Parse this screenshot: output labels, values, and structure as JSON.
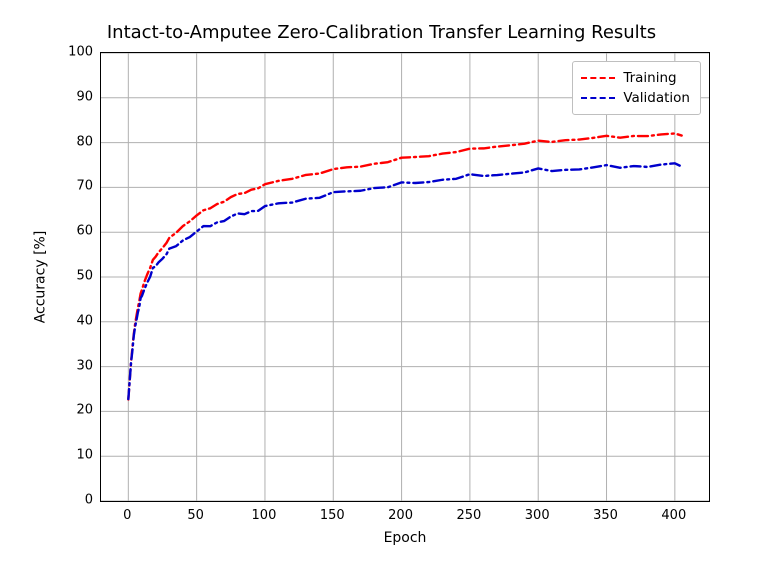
{
  "chart_data": {
    "type": "line",
    "title": "Intact-to-Amputee Zero-Calibration Transfer Learning Results",
    "xlabel": "Epoch",
    "ylabel": "Accuracy [%]",
    "xlim": [
      -20,
      425
    ],
    "ylim": [
      0,
      100
    ],
    "xticks": [
      0,
      50,
      100,
      150,
      200,
      250,
      300,
      350,
      400
    ],
    "yticks": [
      0,
      10,
      20,
      30,
      40,
      50,
      60,
      70,
      80,
      90,
      100
    ],
    "legend_position": "upper right",
    "grid": true,
    "x": [
      0,
      1,
      2,
      3,
      4,
      5,
      6,
      7,
      8,
      9,
      10,
      12,
      14,
      16,
      18,
      20,
      22,
      25,
      28,
      30,
      35,
      40,
      45,
      50,
      55,
      60,
      65,
      70,
      75,
      80,
      85,
      90,
      95,
      100,
      110,
      120,
      130,
      140,
      150,
      160,
      170,
      180,
      190,
      200,
      210,
      220,
      230,
      240,
      250,
      260,
      270,
      280,
      290,
      300,
      310,
      320,
      330,
      340,
      350,
      360,
      370,
      380,
      390,
      400,
      405
    ],
    "series": [
      {
        "name": "Training",
        "color": "#ff0000",
        "style": "dash-dot",
        "values": [
          22.5,
          27.0,
          31.0,
          34.5,
          37.0,
          39.5,
          41.5,
          43.2,
          44.8,
          46.0,
          47.2,
          49.2,
          50.8,
          52.2,
          53.5,
          54.6,
          55.5,
          56.6,
          57.7,
          58.4,
          60.0,
          61.4,
          62.6,
          63.7,
          64.6,
          65.5,
          66.3,
          67.0,
          67.7,
          68.3,
          68.9,
          69.5,
          70.0,
          70.5,
          71.3,
          72.1,
          72.8,
          73.3,
          73.8,
          74.4,
          74.8,
          75.3,
          75.8,
          76.3,
          76.8,
          77.1,
          77.6,
          78.0,
          78.3,
          78.8,
          79.2,
          79.5,
          79.8,
          80.1,
          80.3,
          80.6,
          80.8,
          81.0,
          81.2,
          81.3,
          81.5,
          81.6,
          81.7,
          81.8,
          81.8
        ]
      },
      {
        "name": "Validation",
        "color": "#0000cc",
        "style": "dash-dot",
        "values": [
          22.5,
          27.0,
          31.0,
          34.0,
          36.5,
          38.8,
          40.6,
          42.2,
          43.6,
          44.8,
          45.8,
          47.6,
          49.0,
          50.3,
          51.5,
          52.5,
          53.3,
          54.3,
          55.2,
          55.8,
          57.1,
          58.2,
          59.2,
          60.1,
          60.9,
          61.6,
          62.2,
          62.8,
          63.3,
          63.8,
          64.3,
          64.7,
          65.1,
          65.5,
          66.2,
          66.9,
          67.5,
          68.0,
          68.5,
          69.0,
          69.5,
          69.9,
          70.3,
          70.6,
          71.0,
          71.4,
          71.8,
          72.1,
          72.4,
          72.7,
          72.9,
          73.2,
          73.4,
          73.7,
          73.9,
          74.0,
          74.2,
          74.4,
          74.5,
          74.7,
          74.8,
          74.8,
          74.9,
          75.0,
          75.0
        ]
      }
    ],
    "legend_labels": {
      "training": "Training",
      "validation": "Validation"
    }
  }
}
